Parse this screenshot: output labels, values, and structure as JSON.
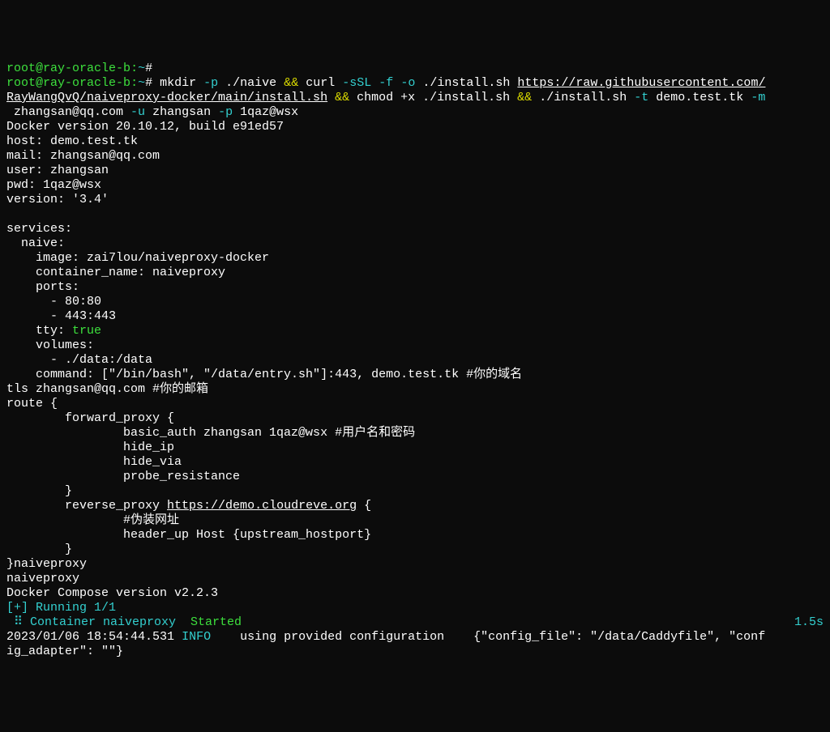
{
  "prompt": {
    "user": "root",
    "host": "ray-oracle-b",
    "path": "~",
    "symbol": "#"
  },
  "cmd1": {
    "mkdir_flag": "-p",
    "mkdir_path": "./naive",
    "and": "&&",
    "curl": "curl",
    "curl_flags": [
      "-sSL",
      "-f",
      "-o"
    ],
    "curl_out": "./install.sh",
    "curl_url1": "https://raw.githubusercontent.com/",
    "curl_url2": "RayWangQvQ/naiveproxy-docker/main/install.sh",
    "chmod": "chmod +x ./install.sh",
    "run": "./install.sh",
    "flag_t": "-t",
    "val_t": "demo.test.tk",
    "flag_m": "-m",
    "val_m": " zhangsan@qq.com",
    "flag_u": "-u",
    "val_u": "zhangsan",
    "flag_p": "-p",
    "val_p": "1qaz@wsx"
  },
  "output": {
    "docker_version": "Docker version 20.10.12, build e91ed57",
    "host": "host: demo.test.tk",
    "mail": "mail: zhangsan@qq.com",
    "user": "user: zhangsan",
    "pwd": "pwd: 1qaz@wsx",
    "version_line": "version: '3.4'",
    "services": "services:",
    "naive": "  naive:",
    "image": "    image: zai7lou/naiveproxy-docker",
    "container_name": "    container_name: naiveproxy",
    "ports": "    ports:",
    "port80": "      - 80:80",
    "port443": "      - 443:443",
    "tty_key": "    tty: ",
    "tty_val": "true",
    "volumes": "    volumes:",
    "volume_line": "      - ./data:/data",
    "command_line": "    command: [\"/bin/bash\", \"/data/entry.sh\"]:443, demo.test.tk #你的域名",
    "tls_line": "tls zhangsan@qq.com #你的邮箱",
    "route_open": "route {",
    "fwd_proxy": "        forward_proxy {",
    "basic_auth": "                basic_auth zhangsan 1qaz@wsx #用户名和密码",
    "hide_ip": "                hide_ip",
    "hide_via": "                hide_via",
    "probe": "                probe_resistance",
    "close1": "        }",
    "rev_proxy_pre": "        reverse_proxy ",
    "rev_proxy_url": "https://demo.cloudreve.org",
    "rev_proxy_post": " {",
    "fake_addr": "                #伪装网址",
    "header_up": "                header_up Host {upstream_hostport}",
    "close2": "        }",
    "close3": "}naiveproxy",
    "naiveproxy": "naiveproxy",
    "compose_version": "Docker Compose version v2.2.3",
    "running": "[+] Running 1/1",
    "container_line_prefix": " ⠿ Container naiveproxy  ",
    "container_started": "Started",
    "container_time": "1.5s",
    "log_ts": "2023/01/06 18:54:44.531",
    "log_level": "INFO",
    "log_msg": "    using provided configuration    {\"config_file\": \"/data/Caddyfile\", \"conf",
    "log_cont": "ig_adapter\": \"\"}"
  }
}
